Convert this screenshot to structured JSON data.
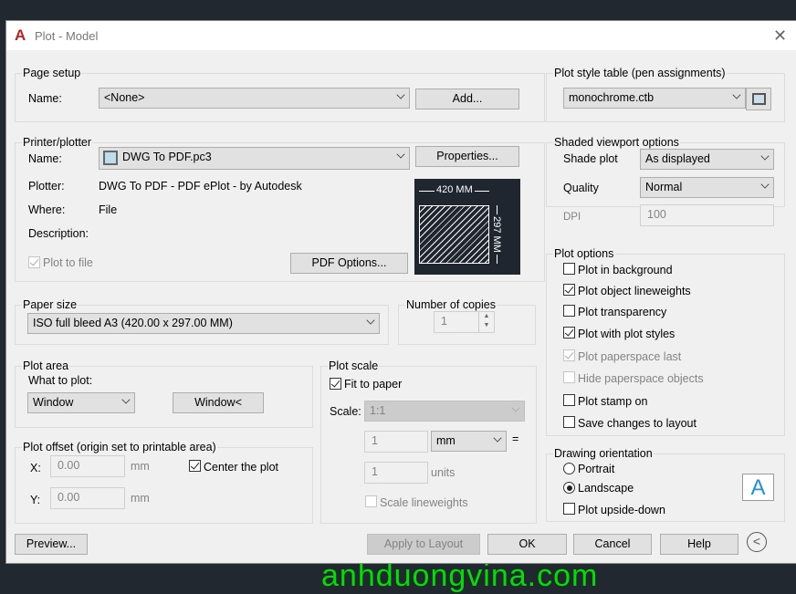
{
  "window": {
    "title": "Plot - Model",
    "close_icon": "close-icon",
    "app_icon": "autocad-logo-icon"
  },
  "page_setup": {
    "title": "Page setup",
    "name_label": "Name:",
    "name_value": "<None>",
    "add_button": "Add..."
  },
  "printer": {
    "title": "Printer/plotter",
    "name_label": "Name:",
    "name_value": "DWG To PDF.pc3",
    "properties_button": "Properties...",
    "plotter_label": "Plotter:",
    "plotter_value": "DWG To PDF - PDF ePlot - by Autodesk",
    "where_label": "Where:",
    "where_value": "File",
    "description_label": "Description:",
    "plot_to_file_label": "Plot to file",
    "plot_to_file_checked": true,
    "pdf_options_button": "PDF Options...",
    "preview_width": "420  MM",
    "preview_height": "297  MM"
  },
  "paper_size": {
    "title": "Paper size",
    "value": "ISO full bleed A3 (420.00 x 297.00 MM)"
  },
  "copies": {
    "title": "Number of copies",
    "value": "1"
  },
  "plot_area": {
    "title": "Plot area",
    "what_label": "What to plot:",
    "what_value": "Window",
    "window_button": "Window<"
  },
  "plot_offset": {
    "title": "Plot offset (origin set to printable area)",
    "x_label": "X:",
    "x_value": "0.00",
    "x_unit": "mm",
    "y_label": "Y:",
    "y_value": "0.00",
    "y_unit": "mm",
    "center_label": "Center the plot",
    "center_checked": true
  },
  "plot_scale": {
    "title": "Plot scale",
    "fit_label": "Fit to paper",
    "fit_checked": true,
    "scale_label": "Scale:",
    "scale_value": "1:1",
    "value1": "1",
    "unit1": "mm",
    "equals": "=",
    "value2": "1",
    "unit2": "units",
    "scale_lw_label": "Scale lineweights",
    "scale_lw_checked": false
  },
  "plot_style": {
    "title": "Plot style table (pen assignments)",
    "value": "monochrome.ctb",
    "edit_icon": "plot-style-edit-icon"
  },
  "shaded": {
    "title": "Shaded viewport options",
    "shade_label": "Shade plot",
    "shade_value": "As displayed",
    "quality_label": "Quality",
    "quality_value": "Normal",
    "dpi_label": "DPI",
    "dpi_value": "100"
  },
  "plot_options": {
    "title": "Plot options",
    "items": [
      {
        "label": "Plot in background",
        "checked": false,
        "enabled": true
      },
      {
        "label": "Plot object lineweights",
        "checked": true,
        "enabled": true
      },
      {
        "label": "Plot transparency",
        "checked": false,
        "enabled": true
      },
      {
        "label": "Plot with plot styles",
        "checked": true,
        "enabled": true
      },
      {
        "label": "Plot paperspace last",
        "checked": true,
        "enabled": false
      },
      {
        "label": "Hide paperspace objects",
        "checked": false,
        "enabled": false
      },
      {
        "label": "Plot stamp on",
        "checked": false,
        "enabled": true
      },
      {
        "label": "Save changes to layout",
        "checked": false,
        "enabled": true
      }
    ]
  },
  "orientation": {
    "title": "Drawing orientation",
    "portrait": "Portrait",
    "landscape": "Landscape",
    "selected": "Landscape",
    "upside_down": "Plot upside-down",
    "upside_down_checked": false,
    "preview_letter": "A"
  },
  "footer": {
    "preview": "Preview...",
    "apply": "Apply to Layout",
    "ok": "OK",
    "cancel": "Cancel",
    "help": "Help",
    "collapse_icon": "chevron-left-circle-icon"
  },
  "background": {
    "watermark": "anhduongvina.com",
    "watermark_color": "#00e000"
  },
  "colors": {
    "accent": "#1e90d8",
    "dialog_bg": "#f0f0f0",
    "canvas_bg": "#212830"
  }
}
